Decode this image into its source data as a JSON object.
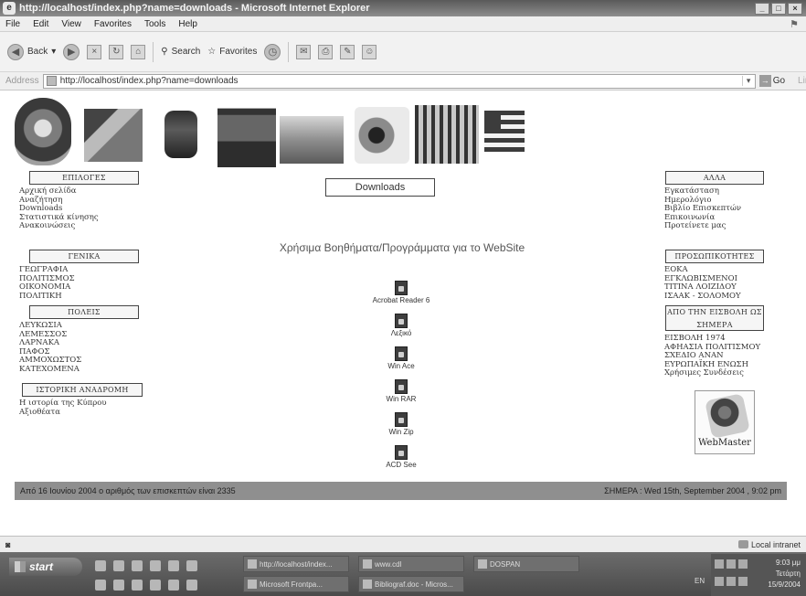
{
  "window": {
    "title": "http://localhost/index.php?name=downloads - Microsoft Internet Explorer",
    "icon": "ie-icon"
  },
  "menu": [
    "File",
    "Edit",
    "View",
    "Favorites",
    "Tools",
    "Help"
  ],
  "toolbar": {
    "back": "Back",
    "search": "Search",
    "favorites": "Favorites"
  },
  "address": {
    "label": "Address",
    "url": "http://localhost/index.php?name=downloads",
    "go": "Go",
    "links": "Links"
  },
  "left_sidebar": {
    "sections": [
      {
        "heading": "ΕΠΙΛΟΓΕΣ",
        "items": [
          "Αρχική σελίδα",
          "Αναζήτηση",
          "Downloads",
          "Στατιστικά κίνησης",
          "Ανακοινώσεις"
        ]
      },
      {
        "heading": "ΓΕΝΙΚΑ",
        "items": [
          "ΓΕΩΓΡΑΦΙΑ",
          "ΠΟΛΙΤΙΣΜΟΣ",
          "ΟΙΚΟΝΟΜΙΑ",
          "ΠΟΛΙΤΙΚΗ"
        ]
      },
      {
        "heading": "ΠΟΛΕΙΣ",
        "items": [
          "ΛΕΥΚΩΣΙΑ",
          "ΛΕΜΕΣΣΟΣ",
          "ΛΑΡΝΑΚΑ",
          "ΠΑΦΟΣ",
          "ΑΜΜΟΧΩΣΤΟΣ",
          "ΚΑΤΕΧΟΜΕΝΑ"
        ]
      },
      {
        "heading": "ΙΣΤΟΡΙΚΗ ΑΝΑΔΡΟΜΗ",
        "items": [
          "Η ιστορία της Κύπρου",
          "Αξιοθέατα"
        ]
      }
    ]
  },
  "right_sidebar": {
    "sections": [
      {
        "heading": "ΑΛΛΑ",
        "items": [
          "Εγκατάσταση",
          "Ημερολόγιο",
          "Βιβλίο Επισκεπτών",
          "Επικοινωνία",
          "Προτείνετε μας"
        ]
      },
      {
        "heading": "ΠΡΟΣΩΠΙΚΟΤΗΤΕΣ",
        "items": [
          "ΕΟΚΑ",
          "ΕΓΚΛΩΒΙΣΜΕΝΟΙ",
          "ΤΙΤΙΝΑ ΛΟΙΖΙΔΟΥ",
          "ΙΣΑΑΚ - ΣΟΛΟΜΟΥ"
        ]
      },
      {
        "heading": "ΑΠΟ ΤΗΝ ΕΙΣΒΟΛΗ ΩΣ ΣΗΜΕΡΑ",
        "items": [
          "ΕΙΣΒΟΛΗ 1974",
          "ΑΦΗΑΣΙΑ ΠΟΛΙΤΙΣΜΟΥ",
          "ΣΧΕΔΙΟ ΑΝΑΝ",
          "ΕΥΡΩΠΑΪΚΗ ΕΝΩΣΗ",
          "Χρήσιμες Συνδέσεις"
        ]
      }
    ],
    "webmaster_label": "WebMaster"
  },
  "main": {
    "heading": "Downloads",
    "subtitle": "Χρήσιμα Βοηθήματα/Προγράμματα για το WebSite",
    "items": [
      "Acrobat Reader 6",
      "Λεξικό",
      "Win Ace",
      "Win RAR",
      "Win Zip",
      "ACD See"
    ]
  },
  "footer": {
    "visitors": "Από 16 Ιουνίου 2004 ο αριθμός των επισκεπτών είναι 2335",
    "date": "ΣΗΜΕΡΑ : Wed 15th, September 2004 , 9:02 pm"
  },
  "status": {
    "zone": "Local intranet"
  },
  "taskbar": {
    "start": "start",
    "tasks_top": [
      "http://localhost/index...",
      "www.cdl",
      "DOSPAN"
    ],
    "tasks_bottom": [
      "Microsoft Frontpa...",
      "Bibliograf.doc - Micros..."
    ],
    "lang": "EN",
    "clock": [
      "9:03 μμ",
      "Τετάρτη",
      "15/9/2004"
    ]
  },
  "colors": {
    "footer_bar": "#8f8f8f",
    "box_border": "#444444"
  }
}
